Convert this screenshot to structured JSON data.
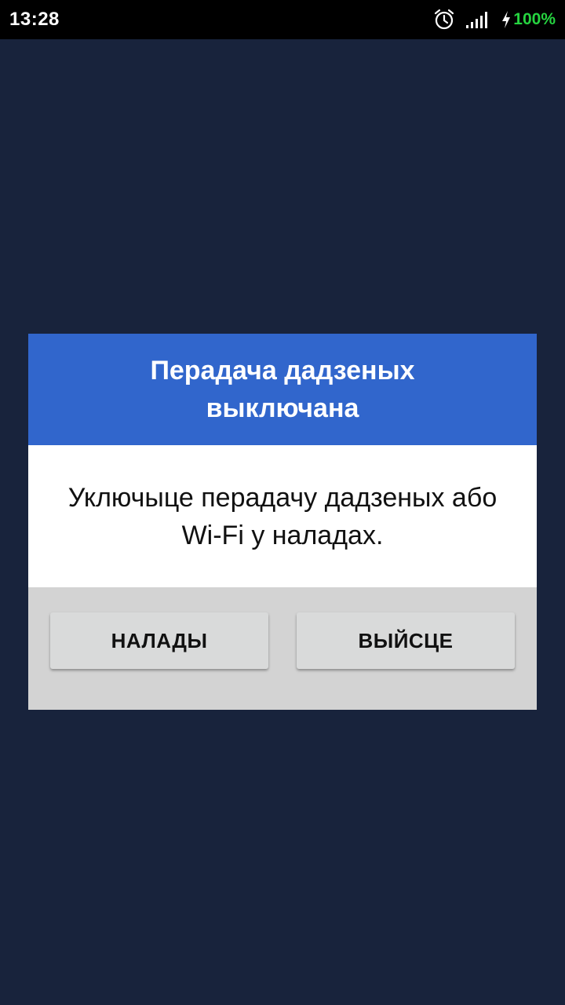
{
  "status_bar": {
    "time": "13:28",
    "battery": "100%",
    "icons": [
      "alarm-icon",
      "signal-icon",
      "charging-bolt-icon"
    ],
    "battery_color": "#26d440"
  },
  "colors": {
    "background": "#18233c",
    "dialog_header": "#3166cc",
    "dialog_body": "#ffffff",
    "dialog_footer": "#d3d3d3",
    "button": "#d9dada"
  },
  "dialog": {
    "title": "Перадача дадзеных выключана",
    "message": "Уключыце перадачу дадзеных або Wi-Fi у наладах.",
    "buttons": {
      "settings": "НАЛАДЫ",
      "exit": "ВЫЙСЦЕ"
    }
  }
}
